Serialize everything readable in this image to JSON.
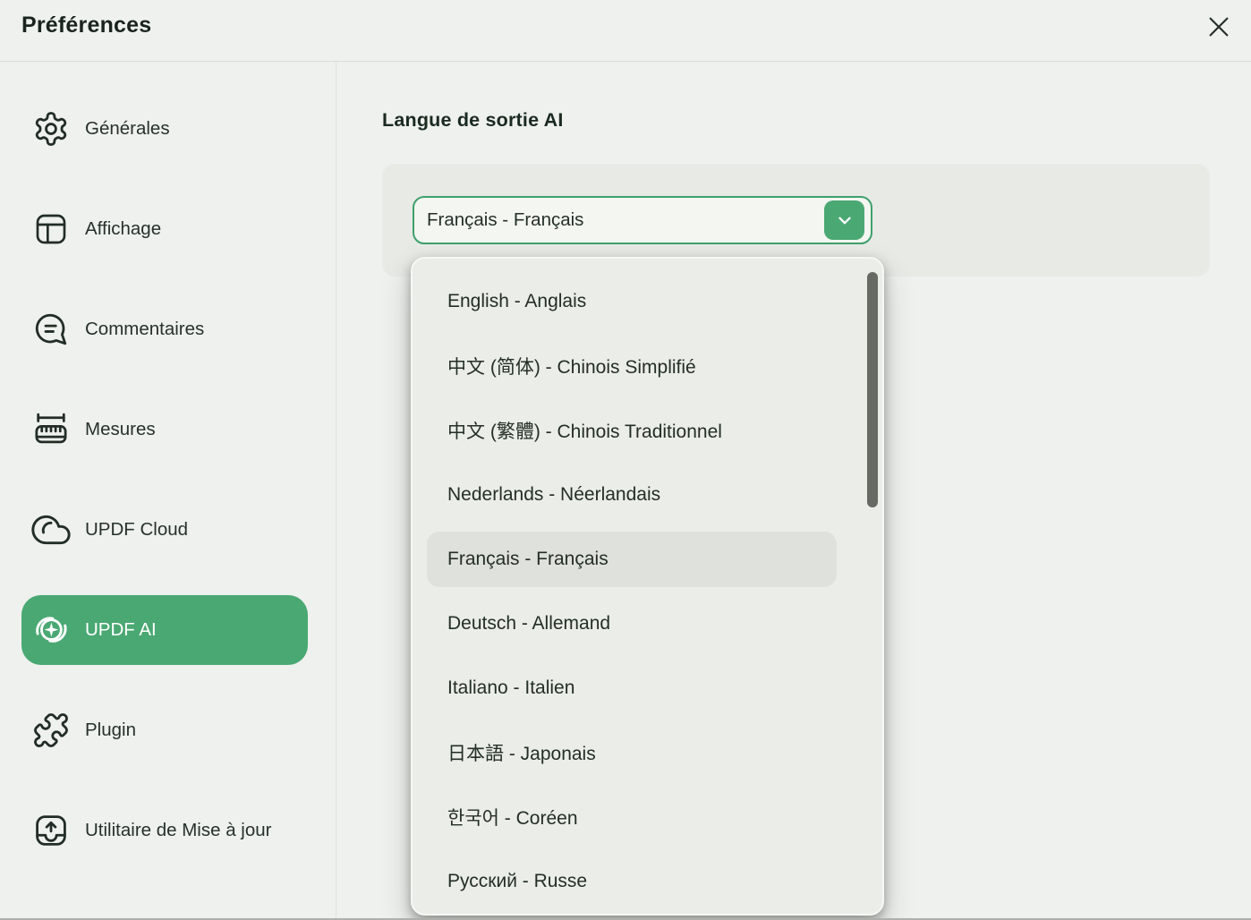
{
  "window": {
    "title": "Préférences"
  },
  "sidebar": {
    "items": [
      {
        "label": "Générales",
        "icon": "gear-icon"
      },
      {
        "label": "Affichage",
        "icon": "layout-icon"
      },
      {
        "label": "Commentaires",
        "icon": "comment-bubble-icon"
      },
      {
        "label": "Mesures",
        "icon": "ruler-icon"
      },
      {
        "label": "UPDF Cloud",
        "icon": "cloud-icon"
      },
      {
        "label": "UPDF AI",
        "icon": "ai-sparkle-icon",
        "active": true
      },
      {
        "label": "Plugin",
        "icon": "puzzle-icon"
      },
      {
        "label": "Utilitaire de Mise à jour",
        "icon": "update-tray-icon"
      }
    ]
  },
  "main": {
    "section_title": "Langue de sortie AI",
    "language_select": {
      "value": "Français - Français",
      "chevron_icon": "chevron-down-icon"
    },
    "dropdown": {
      "options": [
        "English - Anglais",
        "中文 (简体) - Chinois Simplifié",
        "中文 (繁體) - Chinois Traditionnel",
        "Nederlands - Néerlandais",
        "Français - Français",
        "Deutsch - Allemand",
        "Italiano - Italien",
        "日本語 - Japonais",
        "한국어 - Coréen",
        "Русский - Russe"
      ],
      "selected": "Français - Français",
      "selected_index": 4,
      "scrollbar_visible": true
    }
  },
  "colors": {
    "background": "#eef1ed",
    "panel_gray": "#e7eae5",
    "dropdown_bg": "#eaede8",
    "option_highlight": "#dee1dc",
    "accent_green": "#4aa873",
    "select_border_green": "#3fa06c",
    "text_dark": "#242e26",
    "scrollbar_thumb": "#676a63"
  }
}
